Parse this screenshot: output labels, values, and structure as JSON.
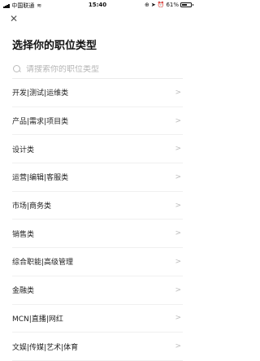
{
  "status_bar": {
    "carrier": "中国联通",
    "time": "15:40",
    "battery_percent": "61%",
    "battery_level": 0.61
  },
  "header": {
    "close_icon": "close-icon",
    "title": "选择你的职位类型"
  },
  "search": {
    "placeholder": "请搜索你的职位类型",
    "value": "",
    "icon": "search-icon"
  },
  "categories": [
    {
      "label": "开发|测试|运维类",
      "icon": "chevron-right-icon"
    },
    {
      "label": "产品|需求|项目类",
      "icon": "chevron-right-icon"
    },
    {
      "label": "设计类",
      "icon": "chevron-right-icon"
    },
    {
      "label": "运营|编辑|客服类",
      "icon": "chevron-right-icon"
    },
    {
      "label": "市场|商务类",
      "icon": "chevron-right-icon"
    },
    {
      "label": "销售类",
      "icon": "chevron-right-icon"
    },
    {
      "label": "综合职能|高级管理",
      "icon": "chevron-right-icon"
    },
    {
      "label": "金融类",
      "icon": "chevron-right-icon"
    },
    {
      "label": "MCN|直播|网红",
      "icon": "chevron-right-icon"
    },
    {
      "label": "文娱|传媒|艺术|体育",
      "icon": "chevron-right-icon"
    }
  ]
}
